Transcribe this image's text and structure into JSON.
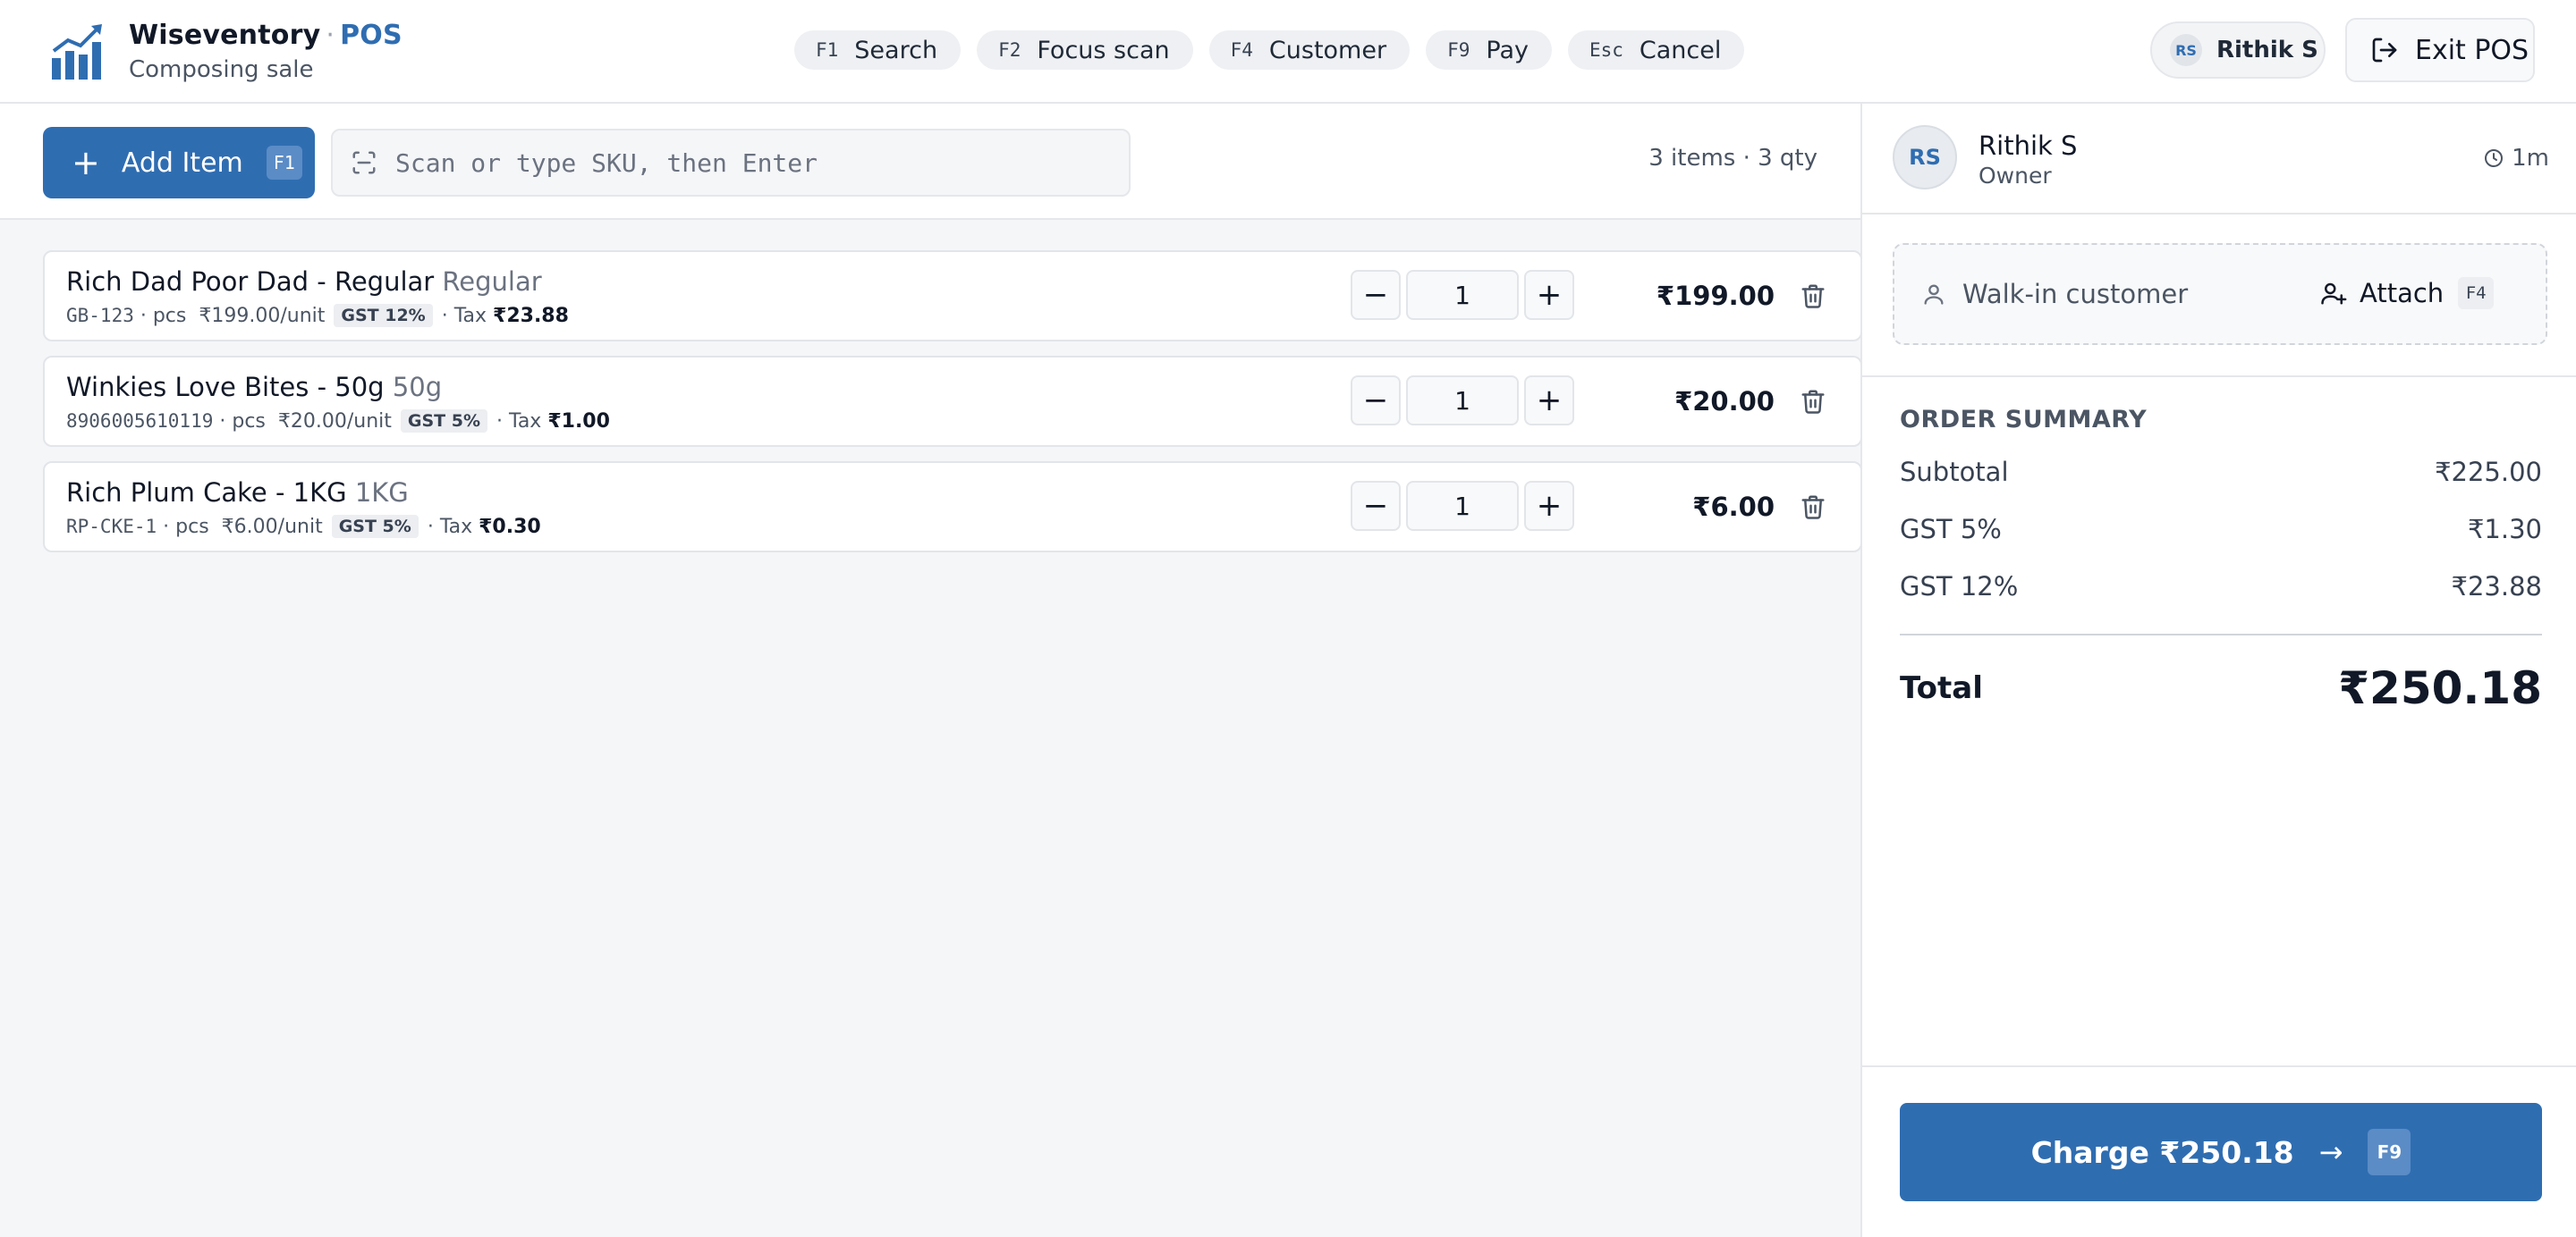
{
  "brand": {
    "name": "Wiseventory",
    "separator": "·",
    "pos": "POS",
    "subtitle": "Composing sale"
  },
  "shortcuts": [
    {
      "key": "F1",
      "label": "Search"
    },
    {
      "key": "F2",
      "label": "Focus scan"
    },
    {
      "key": "F4",
      "label": "Customer"
    },
    {
      "key": "F9",
      "label": "Pay"
    },
    {
      "key": "Esc",
      "label": "Cancel"
    }
  ],
  "user": {
    "initials": "RS",
    "name": "Rithik S"
  },
  "exit_label": "Exit POS",
  "toolbar": {
    "add_label": "Add Item",
    "add_key": "F1",
    "scan_placeholder": "Scan or type SKU, then Enter",
    "counts": "3 items · 3 qty"
  },
  "items": [
    {
      "name": "Rich Dad Poor Dad - Regular",
      "variant": "Regular",
      "sku": "GB-123",
      "unit": "· pcs",
      "unit_price": "₹199.00/unit",
      "gst": "GST 12%",
      "tax_label": "· Tax",
      "tax": "₹23.88",
      "qty": "1",
      "total": "₹199.00"
    },
    {
      "name": "Winkies Love Bites - 50g",
      "variant": "50g",
      "sku": "8906005610119",
      "unit": "· pcs",
      "unit_price": "₹20.00/unit",
      "gst": "GST 5%",
      "tax_label": "· Tax",
      "tax": "₹1.00",
      "qty": "1",
      "total": "₹20.00"
    },
    {
      "name": "Rich Plum Cake - 1KG",
      "variant": "1KG",
      "sku": "RP-CKE-1",
      "unit": "· pcs",
      "unit_price": "₹6.00/unit",
      "gst": "GST 5%",
      "tax_label": "· Tax",
      "tax": "₹0.30",
      "qty": "1",
      "total": "₹6.00"
    }
  ],
  "cashier": {
    "initials": "RS",
    "name": "Rithik S",
    "role": "Owner",
    "elapsed": "1m"
  },
  "customer": {
    "label": "Walk-in customer",
    "attach_label": "Attach",
    "attach_key": "F4"
  },
  "summary": {
    "heading": "ORDER SUMMARY",
    "rows": [
      {
        "label": "Subtotal",
        "value": "₹225.00"
      },
      {
        "label": "GST 5%",
        "value": "₹1.30"
      },
      {
        "label": "GST 12%",
        "value": "₹23.88"
      }
    ],
    "total_label": "Total",
    "total_value": "₹250.18"
  },
  "charge": {
    "label": "Charge ₹250.18",
    "arrow": "→",
    "key": "F9"
  },
  "colors": {
    "accent": "#2f6db1",
    "accent_light": "#5b8cc6",
    "background": "#f4f6f8"
  }
}
